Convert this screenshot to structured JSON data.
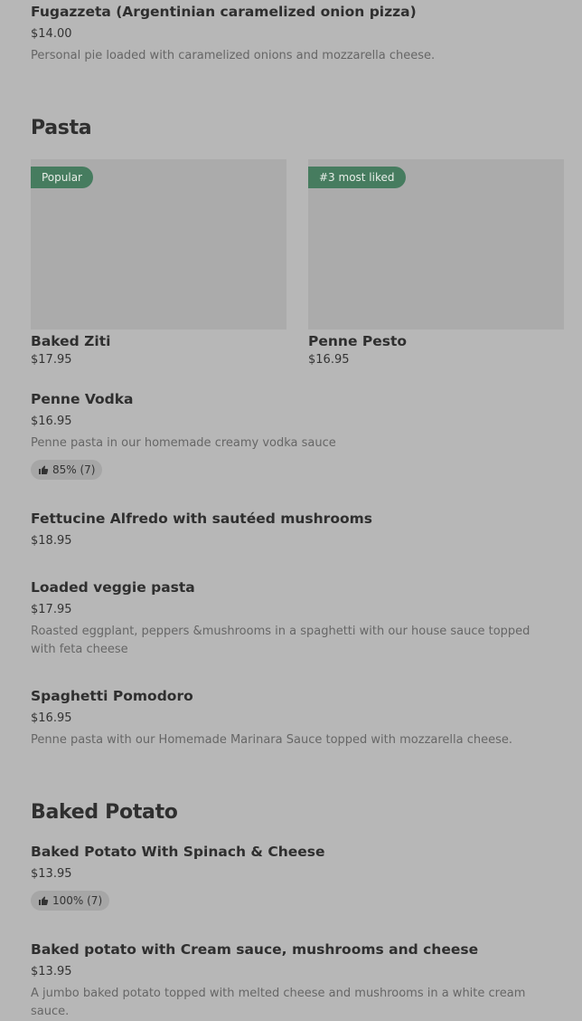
{
  "items": {
    "fugazzeta": {
      "name": "Fugazzeta (Argentinian caramelized onion pizza)",
      "price": "$14.00",
      "desc": "Personal pie loaded with caramelized onions and mozzarella cheese."
    },
    "pasta_section": "Pasta",
    "baked_ziti": {
      "badge": "Popular",
      "name": "Baked Ziti",
      "price": "$17.95"
    },
    "penne_pesto": {
      "badge": "#3 most liked",
      "name": "Penne Pesto",
      "price": "$16.95"
    },
    "penne_vodka": {
      "name": "Penne Vodka",
      "price": "$16.95",
      "desc": "Penne pasta in our homemade creamy vodka sauce",
      "rating": "85% (7)"
    },
    "fettucine": {
      "name": "Fettucine Alfredo with sautéed mushrooms",
      "price": "$18.95"
    },
    "loaded_veggie": {
      "name": "Loaded veggie pasta",
      "price": "$17.95",
      "desc": "Roasted eggplant, peppers &mushrooms in a spaghetti with our house sauce topped with feta cheese"
    },
    "spaghetti": {
      "name": "Spaghetti Pomodoro",
      "price": "$16.95",
      "desc": "Penne pasta with our Homemade Marinara Sauce topped with mozzarella cheese."
    },
    "potato_section": "Baked Potato",
    "potato_spinach": {
      "name": "Baked Potato With Spinach & Cheese",
      "price": "$13.95",
      "rating": "100% (7)"
    },
    "potato_cream": {
      "name": "Baked potato with Cream sauce, mushrooms and cheese",
      "price": "$13.95",
      "desc": "A jumbo baked potato topped with melted cheese and mushrooms in a white cream sauce."
    }
  },
  "colors": {
    "background": "#b7b7b7",
    "badge": "#467c5f",
    "tile": "#ababab"
  },
  "icons": {
    "rating": "thumbs-up-icon"
  }
}
